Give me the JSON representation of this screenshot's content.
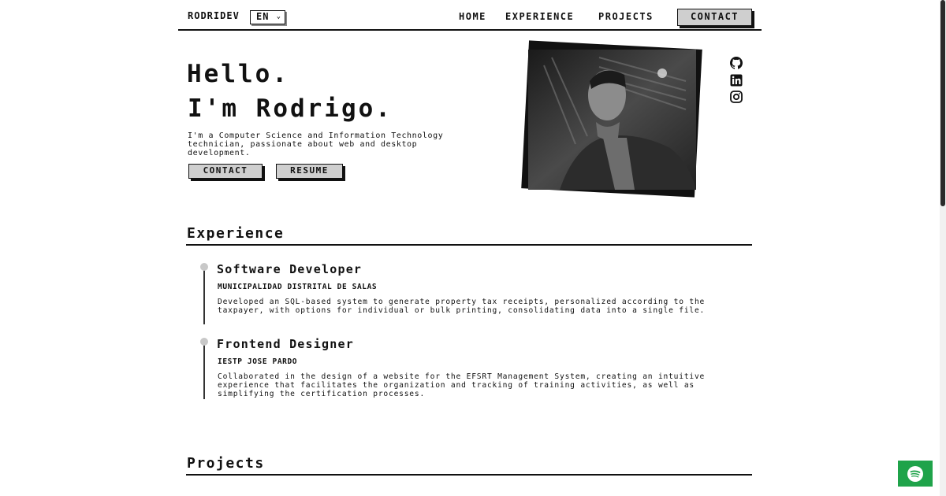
{
  "header": {
    "brand": "RODRIDEV",
    "language": "EN",
    "nav": {
      "home": "HOME",
      "experience": "EXPERIENCE",
      "projects": "PROJECTS",
      "contact": "CONTACT"
    }
  },
  "hero": {
    "greeting": "Hello.",
    "name_line": "I'm Rodrigo.",
    "description": "I'm a Computer Science and Information Technology technician, passionate about web and desktop development.",
    "buttons": {
      "contact": "CONTACT",
      "resume": "RESUME"
    },
    "social_icons": [
      "github-icon",
      "linkedin-icon",
      "instagram-icon"
    ]
  },
  "experience": {
    "title": "Experience",
    "items": [
      {
        "role": "Software Developer",
        "org": "MUNICIPALIDAD DISTRITAL DE SALAS",
        "description": "Developed an SQL-based system to generate property tax receipts, personalized according to the taxpayer, with options for individual or bulk printing, consolidating data into a single file."
      },
      {
        "role": "Frontend Designer",
        "org": "IESTP JOSE PARDO",
        "description": "Collaborated in the design of a website for the EFSRT Management System, creating an intuitive experience that facilitates the organization and tracking of training activities, as well as simplifying the certification processes."
      }
    ]
  },
  "projects": {
    "title": "Projects"
  },
  "floating": {
    "icon": "spotify-icon",
    "color": "#1fa34a"
  }
}
